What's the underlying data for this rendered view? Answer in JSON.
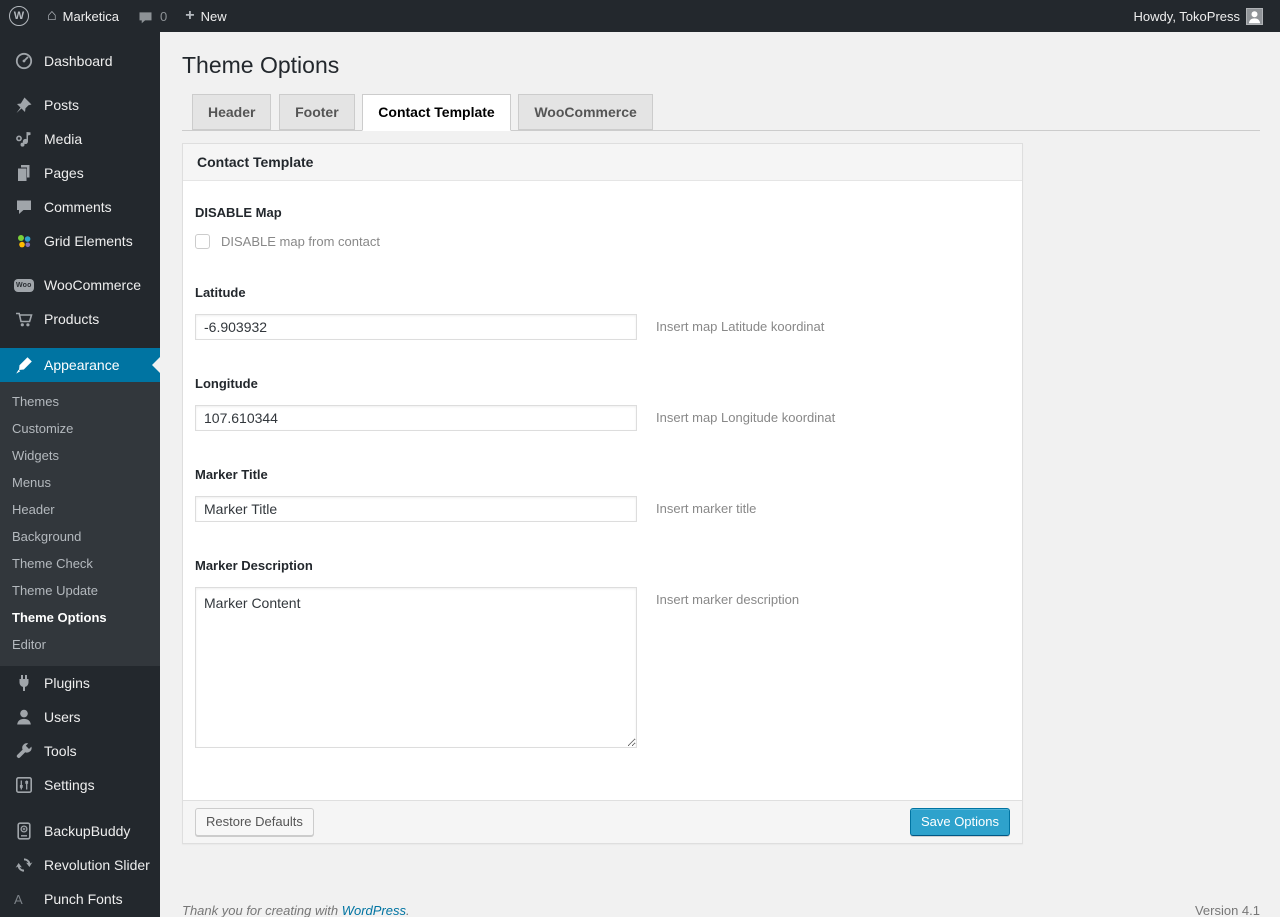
{
  "admin_bar": {
    "site_name": "Marketica",
    "comment_count": "0",
    "new_label": "New",
    "howdy": "Howdy, TokoPress"
  },
  "icons": {
    "wp_logo": "W",
    "home": "⌂",
    "new_plus": "+",
    "woo_badge": "Woo",
    "punch_fonts_letter": "A"
  },
  "sidebar": {
    "items": [
      {
        "label": "Dashboard"
      },
      {
        "label": "Posts"
      },
      {
        "label": "Media"
      },
      {
        "label": "Pages"
      },
      {
        "label": "Comments"
      },
      {
        "label": "Grid Elements"
      },
      {
        "label": "WooCommerce"
      },
      {
        "label": "Products"
      },
      {
        "label": "Appearance",
        "active": true
      },
      {
        "label": "Plugins"
      },
      {
        "label": "Users"
      },
      {
        "label": "Tools"
      },
      {
        "label": "Settings"
      },
      {
        "label": "BackupBuddy"
      },
      {
        "label": "Revolution Slider"
      },
      {
        "label": "Punch Fonts"
      }
    ],
    "appearance_submenu": [
      {
        "label": "Themes"
      },
      {
        "label": "Customize"
      },
      {
        "label": "Widgets"
      },
      {
        "label": "Menus"
      },
      {
        "label": "Header"
      },
      {
        "label": "Background"
      },
      {
        "label": "Theme Check"
      },
      {
        "label": "Theme Update"
      },
      {
        "label": "Theme Options",
        "current": true
      },
      {
        "label": "Editor"
      }
    ]
  },
  "page": {
    "title": "Theme Options"
  },
  "tabs": [
    {
      "label": "Header"
    },
    {
      "label": "Footer"
    },
    {
      "label": "Contact Template",
      "active": true
    },
    {
      "label": "WooCommerce"
    }
  ],
  "panel": {
    "header": "Contact Template"
  },
  "form": {
    "disable_map": {
      "label": "DISABLE Map",
      "checkbox_label": "DISABLE map from contact",
      "checked": false
    },
    "latitude": {
      "label": "Latitude",
      "value": "-6.903932",
      "hint": "Insert map Latitude koordinat"
    },
    "longitude": {
      "label": "Longitude",
      "value": "107.610344",
      "hint": "Insert map Longitude koordinat"
    },
    "marker_title": {
      "label": "Marker Title",
      "value": "Marker Title",
      "hint": "Insert marker title"
    },
    "marker_description": {
      "label": "Marker Description",
      "value": "Marker Content",
      "hint": "Insert marker description"
    }
  },
  "footer_buttons": {
    "restore": "Restore Defaults",
    "save": "Save Options"
  },
  "page_footer": {
    "thanks_prefix": "Thank you for creating with ",
    "wordpress_link": "WordPress",
    "thanks_suffix": ".",
    "version": "Version 4.1"
  },
  "colors": {
    "menu_active_blue": "#0074a2",
    "primary_button_blue": "#2ea2cc",
    "admin_dark": "#23282d",
    "page_background": "#f1f1f1"
  }
}
